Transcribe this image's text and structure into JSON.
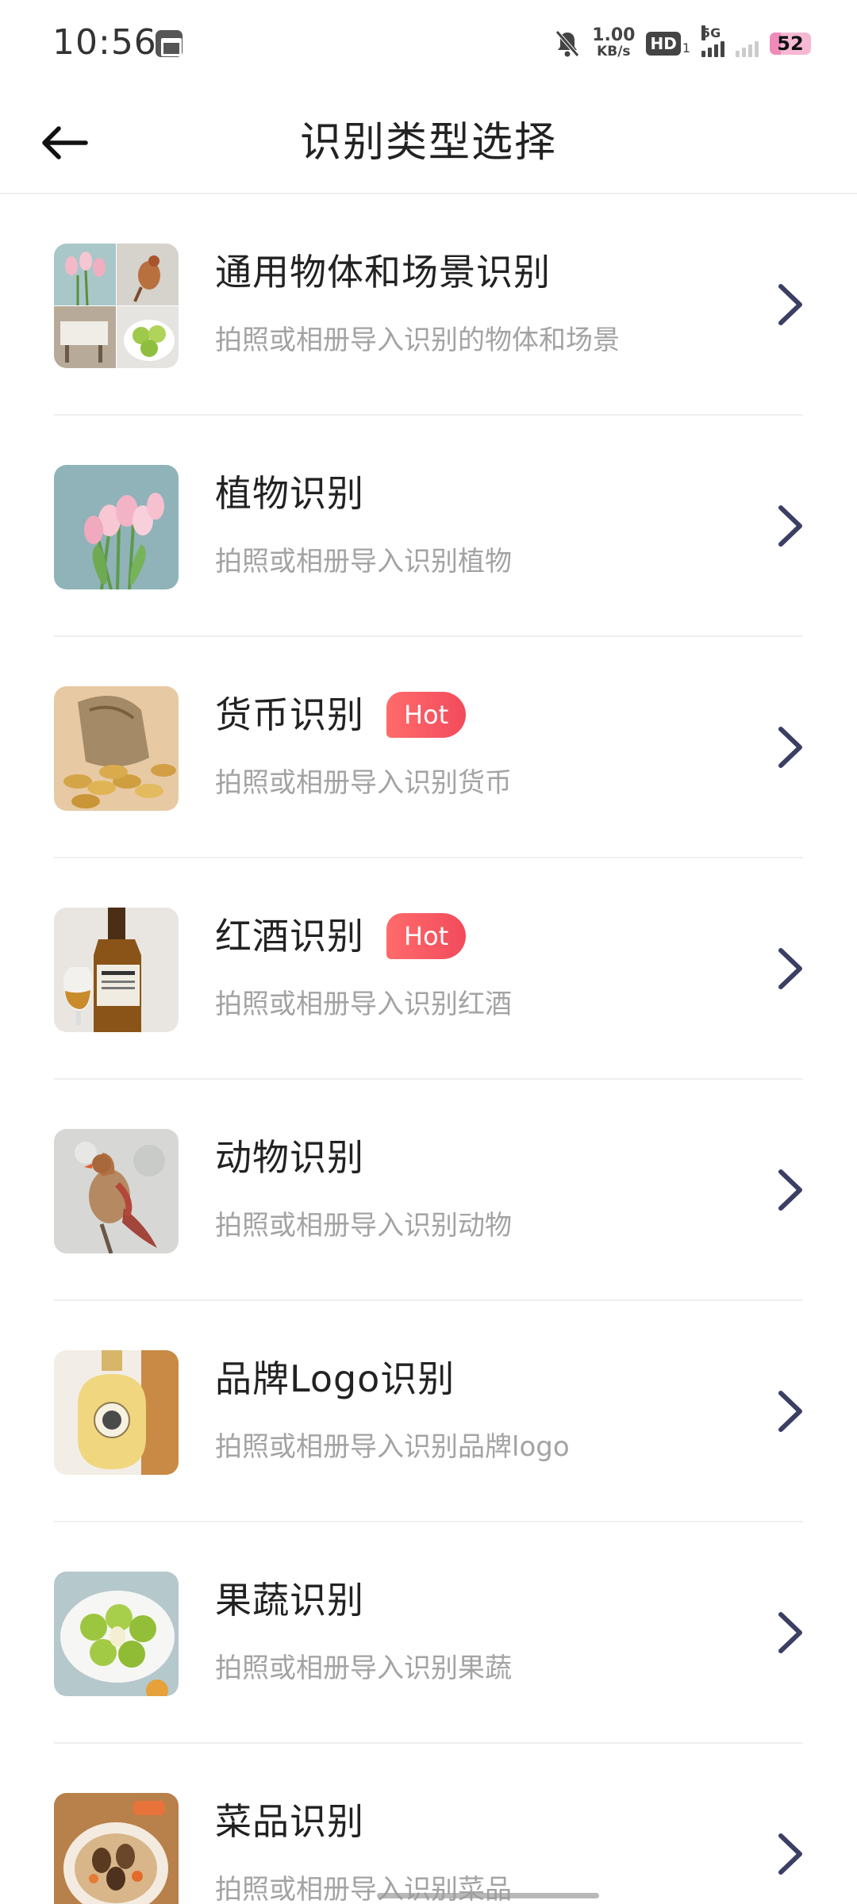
{
  "status_bar": {
    "time": "10:56",
    "net_speed_value": "1.00",
    "net_speed_unit": "KB/s",
    "hd_label": "HD",
    "hd_sub": "1",
    "network_type": "5G",
    "battery": "52"
  },
  "header": {
    "title": "识别类型选择"
  },
  "badge_hot": "Hot",
  "items": [
    {
      "title": "通用物体和场景识别",
      "desc": "拍照或相册导入识别的物体和场景",
      "hot": false,
      "thumb": "collage-icon"
    },
    {
      "title": "植物识别",
      "desc": "拍照或相册导入识别植物",
      "hot": false,
      "thumb": "tulip-icon"
    },
    {
      "title": "货币识别",
      "desc": "拍照或相册导入识别货币",
      "hot": true,
      "thumb": "coins-icon"
    },
    {
      "title": "红酒识别",
      "desc": "拍照或相册导入识别红酒",
      "hot": true,
      "thumb": "whisky-bottle-icon"
    },
    {
      "title": "动物识别",
      "desc": "拍照或相册导入识别动物",
      "hot": false,
      "thumb": "cardinal-bird-icon"
    },
    {
      "title": "品牌Logo识别",
      "desc": "拍照或相册导入识别品牌logo",
      "hot": false,
      "thumb": "perfume-bottle-icon"
    },
    {
      "title": "果蔬识别",
      "desc": "拍照或相册导入识别果蔬",
      "hot": false,
      "thumb": "green-fruit-icon"
    },
    {
      "title": "菜品识别",
      "desc": "拍照或相册导入识别菜品",
      "hot": false,
      "thumb": "dish-icon"
    }
  ],
  "colors": {
    "title_text": "#222222",
    "desc_text": "#a3a3a3",
    "chevron": "#3b3f63",
    "hot_badge": "#f24b5c",
    "divider": "#efefef"
  }
}
